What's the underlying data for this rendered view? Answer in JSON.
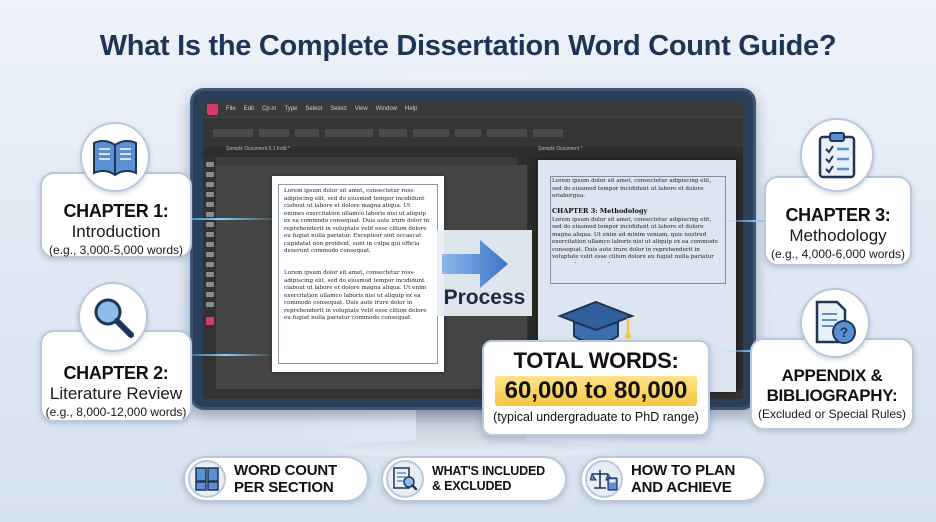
{
  "title": "What Is the Complete Dissertation Word Count Guide?",
  "colors": {
    "accent": "#1e3558",
    "highlight": "#f6c645",
    "arrow": "#4a86d6"
  },
  "app": {
    "menu": [
      "File",
      "Edit",
      "Cp.m",
      "Type",
      "Select",
      "Select",
      "View",
      "Window",
      "Help"
    ],
    "tab_left": "Sample Document 5.1.Indd *",
    "tab_right": "Sample Document *",
    "status_left": "",
    "document_left": {
      "para1": "Lorem ipsum dolor sit amet, consectetur ross-adipiscing elit, sed do eiusmod tempor incididunt ciabout ut labore et dolore magna aliqua. Ut enimes exercitation ullamco laboris nisi ut aliquip ex ea commodo consequat. Duis aute irure dolor in reprehenderit in voluptate velit esse cillum dolore eu fugiat nulla pariatur. Excepteur sint occaecat cupidatat non proident, sunt in culpa qui officia deserunt commodo consequat.",
      "para2": "Lorem ipsum dolor sit amet, consectetur ross-adipiscing elit, sed do eiusmod tempor incididunt ciabout ut labore et dolore magna aliqua. Ut enim exercitation ullamco laboris nisi ut aliquip ex ea commodo consequat. Duis aute irure dolor in reprehenderit in voluptate velit esse cillum dolore eu fugiat nulla pariatur commodo consequat."
    },
    "document_right": {
      "para1": "Lorem ipsum dolor sit amet, consectetur adipiscing elit, sed do eiusmod tempor incididunt ut labore et dolore eriaborgua.",
      "heading": "CHAPTER 3: Methodology",
      "para2": "Lorem ipsum dolor sit amet, consectetur adipiscing elit, sed do eiusmod tempor incididunt ut labore et dolore magna aliqua. Ut enim ad minim veniam, quis nostrud exercitation ullamco laboris nisi ut aliquip ex ea commodo consequat. Duis aute irure dolor in reprehenderit in voluptate velit esse cillum dolore eu fugiat nulla pariatur commodo consequat."
    }
  },
  "process_label": "Process",
  "chapters": {
    "ch1": {
      "title": "CHAPTER 1:",
      "name": "Introduction",
      "note": "(e.g., 3,000-5,000 words)",
      "icon": "book-icon"
    },
    "ch2": {
      "title": "CHAPTER 2:",
      "name": "Literature Review",
      "note": "(e.g., 8,000-12,000 words)",
      "icon": "magnifier-icon"
    },
    "ch3": {
      "title": "CHAPTER 3:",
      "name": "Methodology",
      "note": "(e.g., 4,000-6,000 words)",
      "icon": "clipboard-icon"
    },
    "appendix": {
      "title1": "APPENDIX &",
      "title2": "BIBLIOGRAPHY:",
      "note": "(Excluded or Special Rules)",
      "icon": "document-question-icon"
    }
  },
  "total": {
    "label": "TOTAL WORDS:",
    "range": "60,000 to 80,000",
    "note": "(typical undergraduate to PhD range)",
    "icon": "graduation-cap-icon"
  },
  "buttons": [
    {
      "line1": "WORD COUNT",
      "line2": "PER SECTION",
      "icon": "documents-icon"
    },
    {
      "line1": "WHAT'S INCLUDED",
      "line2": "& EXCLUDED",
      "icon": "document-search-icon"
    },
    {
      "line1": "HOW TO PLAN",
      "line2": "AND ACHIEVE",
      "icon": "scale-calculator-icon"
    }
  ]
}
